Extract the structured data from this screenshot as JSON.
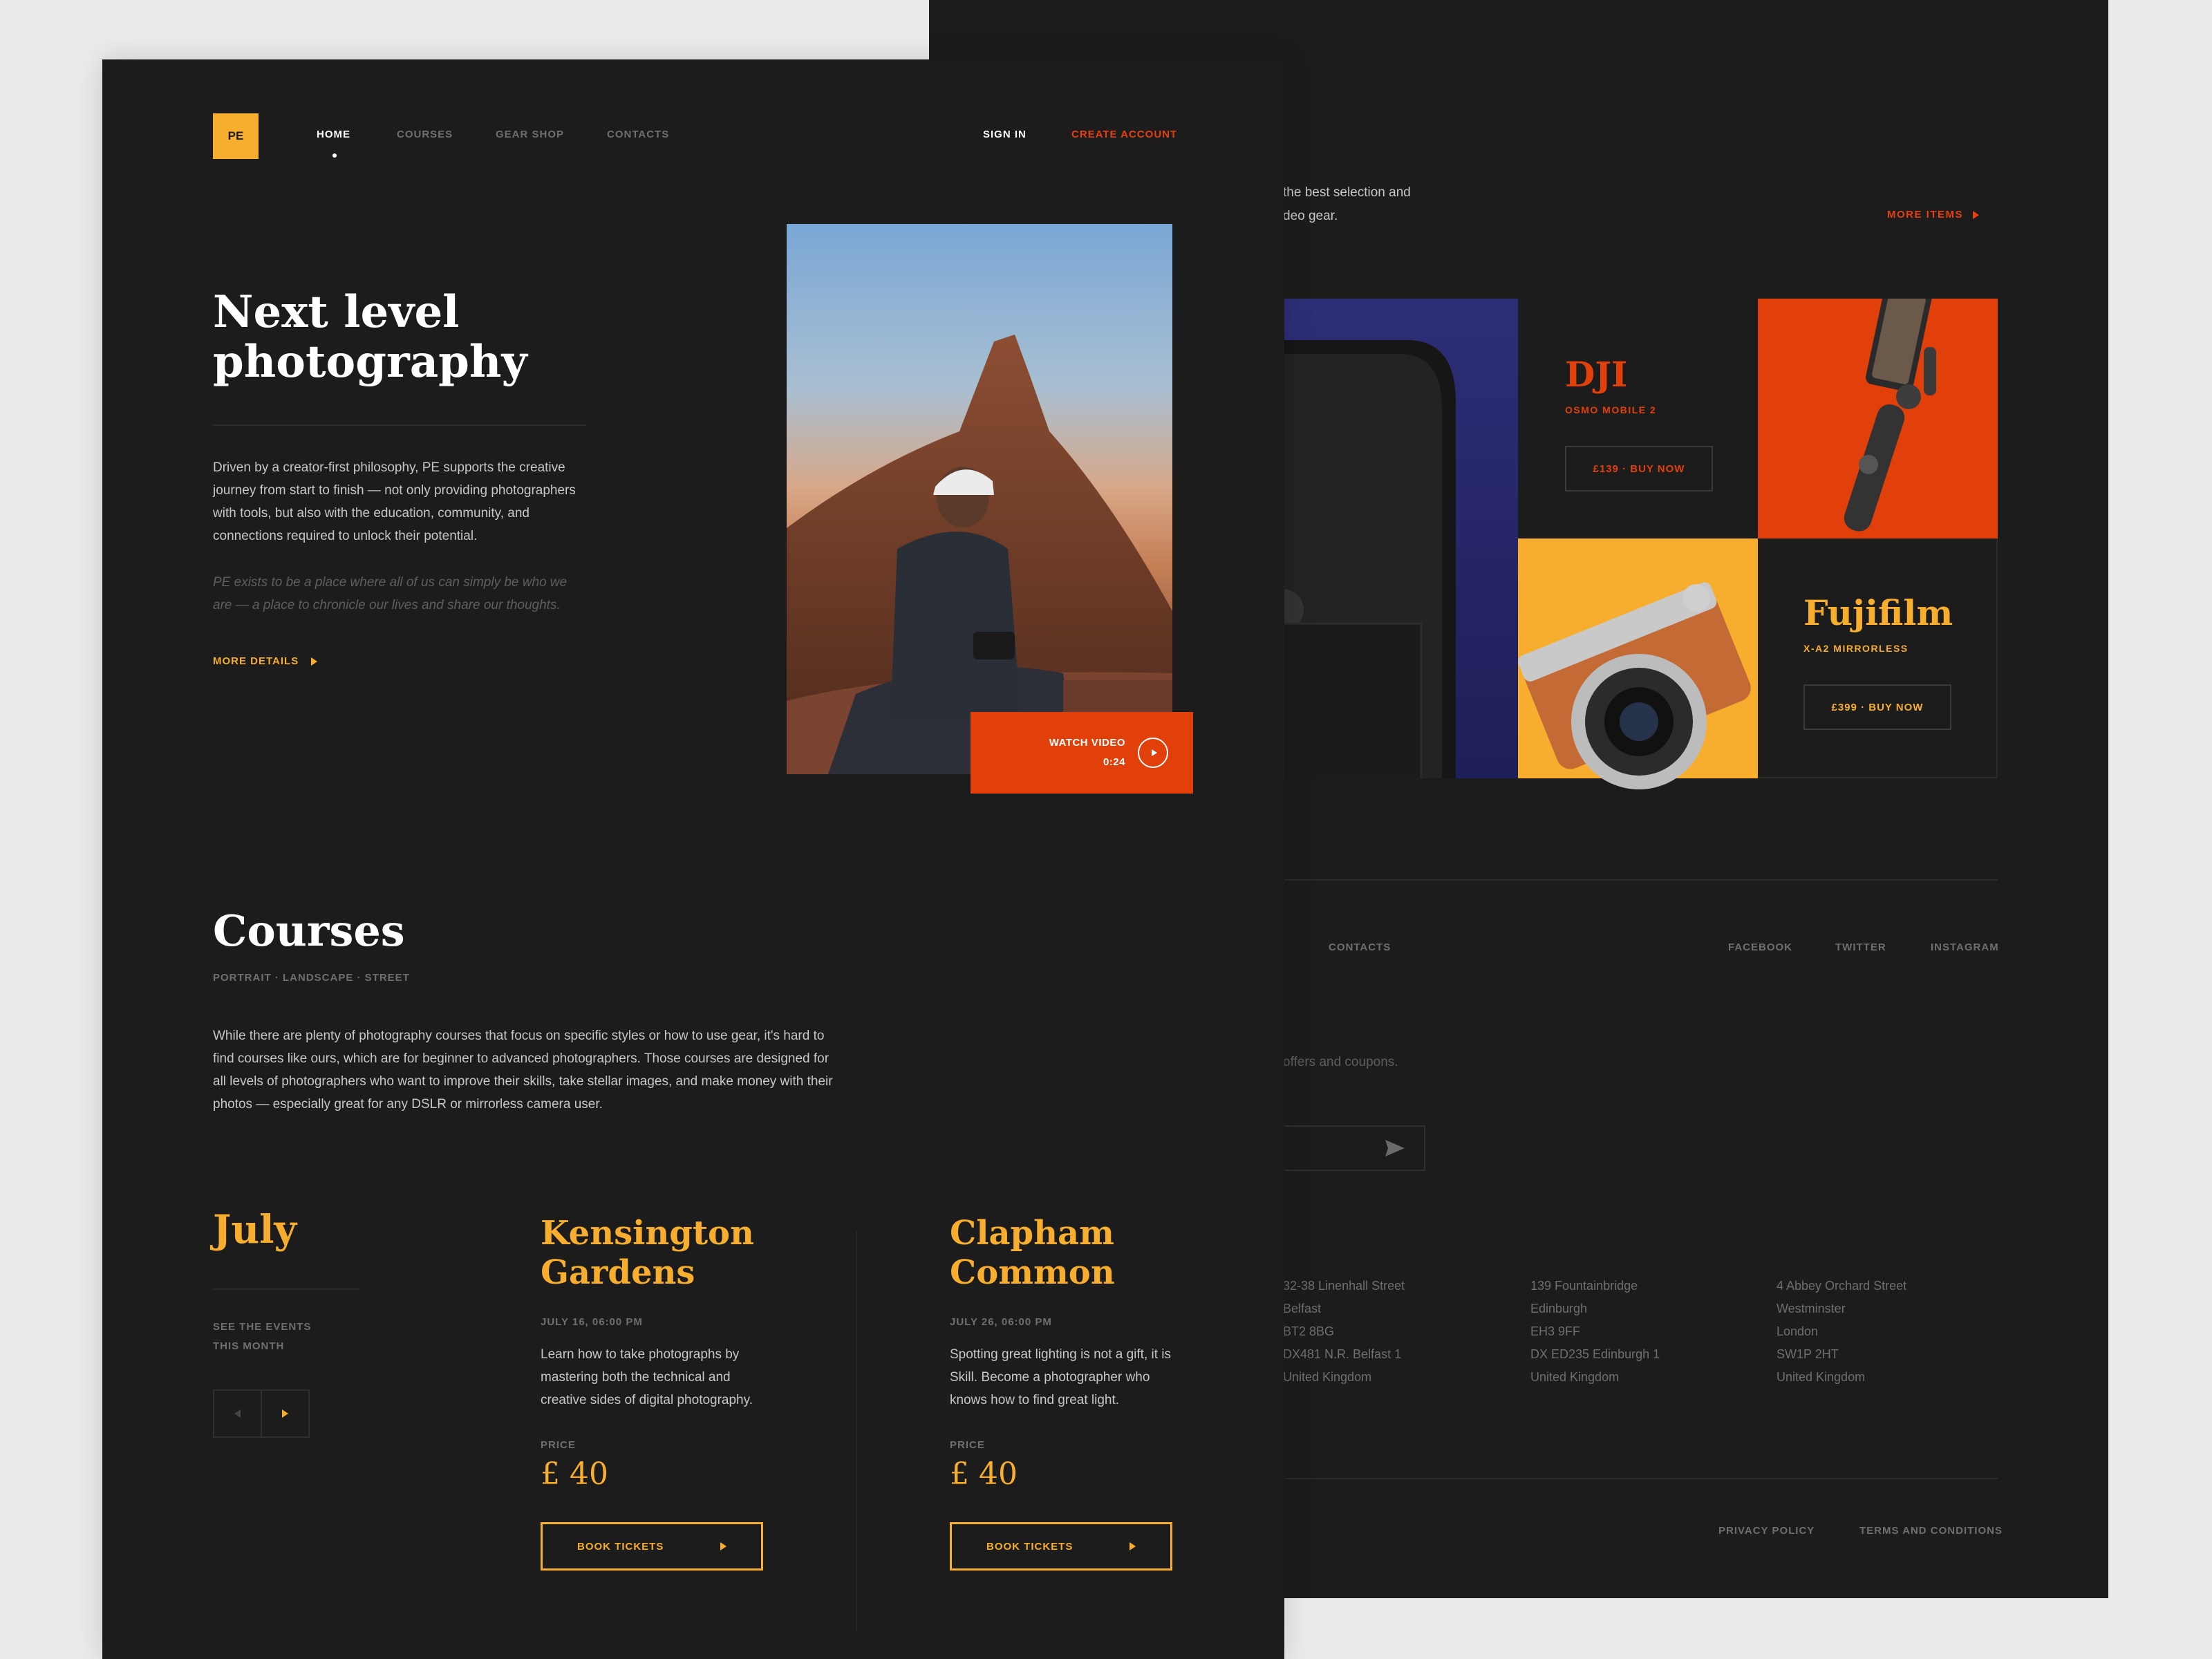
{
  "colors": {
    "accent_yellow": "#f7ad2d",
    "accent_orange": "#e2400a",
    "background": "#1c1c1c",
    "outer_background": "#ebebeb"
  },
  "logo": {
    "text": "PE"
  },
  "nav": {
    "items": [
      {
        "label": "HOME",
        "active": true
      },
      {
        "label": "COURSES",
        "active": false
      },
      {
        "label": "GEAR SHOP",
        "active": false
      },
      {
        "label": "CONTACTS",
        "active": false
      }
    ],
    "sign_in": "SIGN IN",
    "create_account": "CREATE ACCOUNT"
  },
  "hero": {
    "title_line1": "Next level",
    "title_line2": "photography",
    "text": "Driven by a creator-first philosophy, PE supports the creative journey from start to finish — not only providing photographers with tools, but also with the education, community, and connections required to unlock their potential.",
    "italic_text": "PE exists to be a place where all of us can simply be who we are — a place to chronicle our lives and share our thoughts.",
    "more_details": "MORE DETAILS",
    "watch_video": "WATCH VIDEO",
    "video_duration": "0:24"
  },
  "courses": {
    "title": "Courses",
    "tags": "PORTRAIT · LANDSCAPE · STREET",
    "text": "While there are plenty of photography courses that focus on specific styles or how to use gear, it's hard to find courses like ours, which are for beginner to advanced photographers. Those courses are designed for all levels of photographers who want to improve their skills, take stellar images, and make money with their photos — especially great for any DSLR or mirrorless camera user.",
    "month": "July",
    "see_events_line1": "SEE THE EVENTS",
    "see_events_line2": "THIS MONTH",
    "events": [
      {
        "title_line1": "Kensington",
        "title_line2": "Gardens",
        "date": "JULY 16, 06:00 PM",
        "description": "Learn how to take photographs by mastering both the technical and creative sides of digital photography.",
        "price_label": "PRICE",
        "price": "£ 40",
        "button": "BOOK TICKETS"
      },
      {
        "title_line1": "Clapham",
        "title_line2": "Common",
        "date": "JULY 26, 06:00 PM",
        "description": "Spotting great lighting is not a gift, it is Skill. Become a photographer who knows how to find great light.",
        "price_label": "PRICE",
        "price": "£ 40",
        "button": "BOOK TICKETS"
      }
    ]
  },
  "gear": {
    "intro_line1": "the best selection and",
    "intro_line2": "deo gear.",
    "more_items": "MORE ITEMS",
    "products": [
      {
        "brand": "DJI",
        "model": "OSMO MOBILE 2",
        "button": "£139 · BUY NOW",
        "color": "#e2400a"
      },
      {
        "brand": "Fujifilm",
        "model": "X-A2 MIRRORLESS",
        "button": "£399 · BUY NOW",
        "color": "#f7ad2d"
      }
    ]
  },
  "footer": {
    "contacts": "CONTACTS",
    "social": [
      "FACEBOOK",
      "TWITTER",
      "INSTAGRAM"
    ],
    "newsletter_text": "offers and coupons.",
    "addresses": [
      [
        "32-38 Linenhall Street",
        "Belfast",
        "BT2 8BG",
        "DX481 N.R. Belfast 1",
        "United Kingdom"
      ],
      [
        "139 Fountainbridge",
        "Edinburgh",
        "EH3 9FF",
        "DX ED235 Edinburgh 1",
        "United Kingdom"
      ],
      [
        "4 Abbey Orchard Street",
        "Westminster",
        "London",
        "SW1P 2HT",
        "United Kingdom"
      ]
    ],
    "privacy": "PRIVACY POLICY",
    "terms": "TERMS AND CONDITIONS"
  }
}
